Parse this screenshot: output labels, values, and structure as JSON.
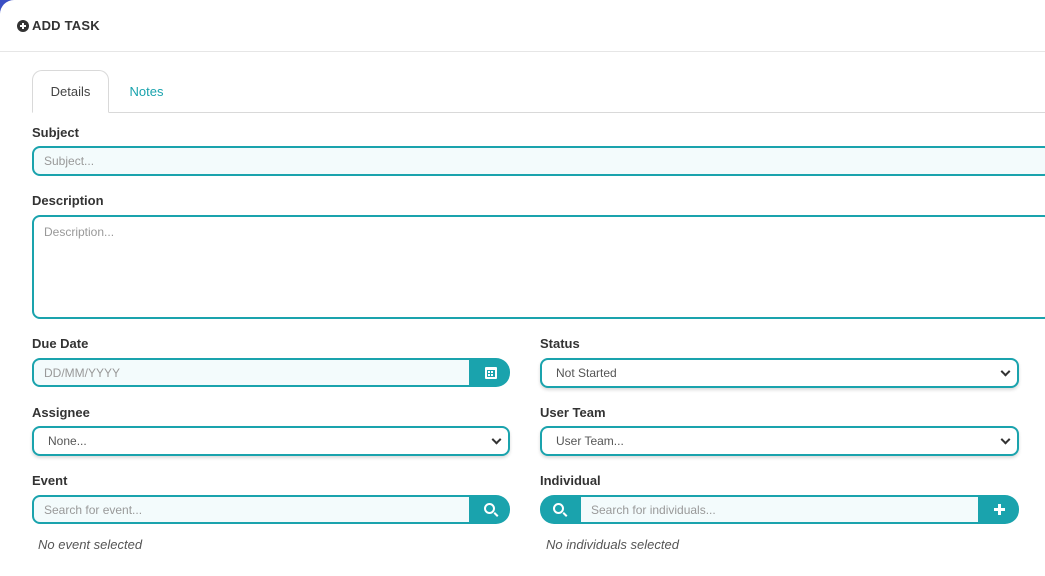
{
  "header": {
    "title": "ADD TASK",
    "icon": "plus-circle-icon"
  },
  "tabs": [
    {
      "label": "Details",
      "active": true
    },
    {
      "label": "Notes",
      "active": false
    }
  ],
  "colors": {
    "accent": "#1aa3ad",
    "corner": "#3b4fc4"
  },
  "form": {
    "subject": {
      "label": "Subject",
      "placeholder": "Subject..."
    },
    "description": {
      "label": "Description",
      "placeholder": "Description..."
    },
    "due_date": {
      "label": "Due Date",
      "placeholder": "DD/MM/YYYY",
      "icon": "calendar-icon"
    },
    "status": {
      "label": "Status",
      "value": "Not Started"
    },
    "assignee": {
      "label": "Assignee",
      "value": "None..."
    },
    "user_team": {
      "label": "User Team",
      "value": "User Team..."
    },
    "event": {
      "label": "Event",
      "placeholder": "Search for event...",
      "icon": "search-icon",
      "empty_text": "No event selected"
    },
    "individual": {
      "label": "Individual",
      "placeholder": "Search for individuals...",
      "search_icon": "search-icon",
      "add_icon": "plus-icon",
      "empty_text": "No individuals selected"
    }
  }
}
